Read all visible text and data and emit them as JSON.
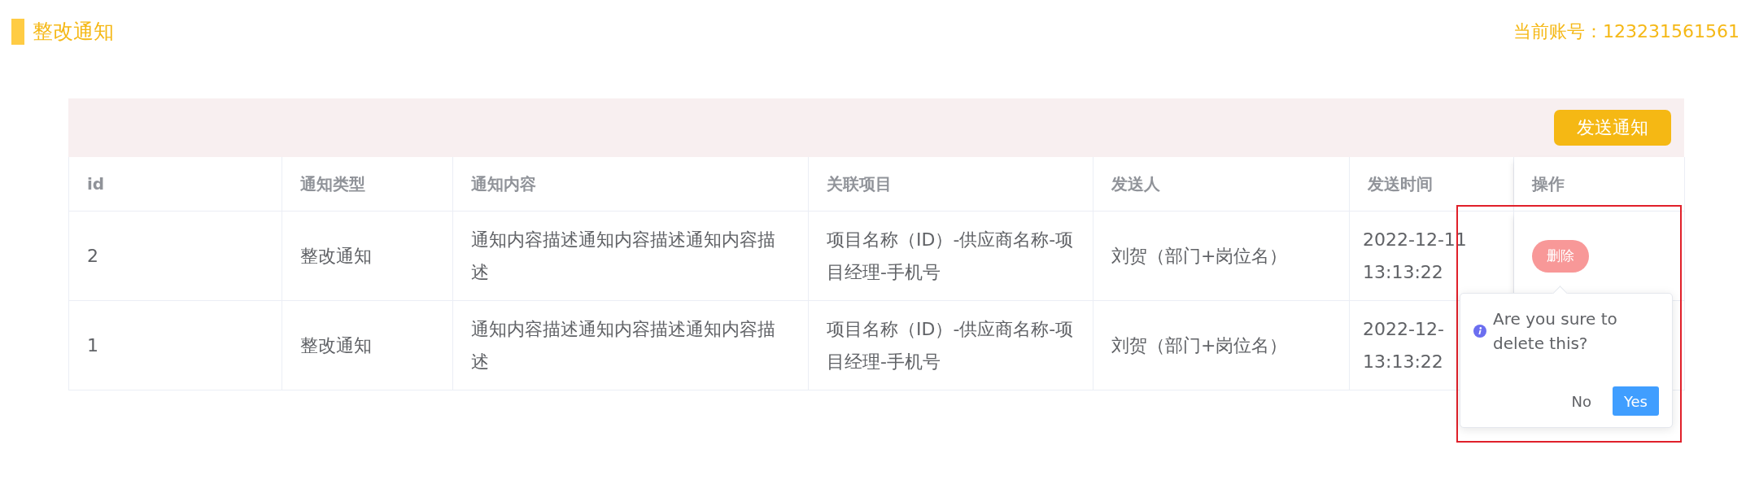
{
  "header": {
    "title": "整改通知",
    "account": "当前账号：123231561561"
  },
  "toolbar": {
    "send_button": "发送通知"
  },
  "table": {
    "columns": [
      "id",
      "通知类型",
      "通知内容",
      "关联项目",
      "发送人",
      "发送时间",
      "操作"
    ],
    "rows": [
      {
        "id": "2",
        "type": "整改通知",
        "content": "通知内容描述通知内容描述通知内容描述",
        "project": "项目名称（ID）-供应商名称-项目经理-手机号",
        "sender": "刘贺（部门+岗位名）",
        "date": "2022-12-11",
        "time": "13:13:22",
        "action": "删除"
      },
      {
        "id": "1",
        "type": "整改通知",
        "content": "通知内容描述通知内容描述通知内容描述",
        "project": "项目名称（ID）-供应商名称-项目经理-手机号",
        "sender": "刘贺（部门+岗位名）",
        "date": "2022-12-",
        "time": "13:13:22"
      }
    ]
  },
  "popconfirm": {
    "message": "Are you sure to delete this?",
    "cancel": "No",
    "confirm": "Yes"
  }
}
